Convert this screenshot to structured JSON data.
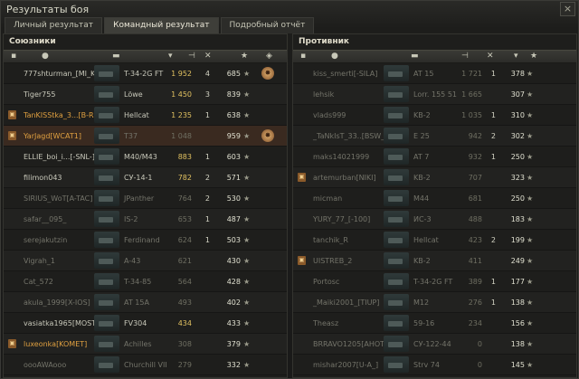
{
  "window": {
    "title": "Результаты боя",
    "close_label": "×"
  },
  "tabs": [
    {
      "label": "Личный результат",
      "active": false
    },
    {
      "label": "Командный результат",
      "active": true
    },
    {
      "label": "Подробный отчёт",
      "active": false
    }
  ],
  "allies": {
    "title": "Союзники",
    "rows": [
      {
        "player": "777shturman_[MI_KI]",
        "vehicle": "T-34-2G FT",
        "damage": "1 952",
        "kills": "4",
        "xp": "685",
        "dead": false,
        "platoon": false,
        "medal": true
      },
      {
        "player": "Tiger755",
        "vehicle": "Löwe",
        "damage": "1 450",
        "kills": "3",
        "xp": "839",
        "dead": false,
        "platoon": false,
        "medal": false
      },
      {
        "player": "TanKISStka_3...[B-RS]",
        "vehicle": "Hellcat",
        "damage": "1 235",
        "kills": "1",
        "xp": "638",
        "dead": false,
        "platoon": true,
        "medal": false,
        "orange": true
      },
      {
        "player": "YarJagd[WCAT1]",
        "vehicle": "T37",
        "damage": "1 048",
        "kills": "",
        "xp": "959",
        "dead": true,
        "platoon": true,
        "medal": true,
        "highlight": true,
        "orange": true
      },
      {
        "player": "ELLIE_boi_i...[-SNL-]",
        "vehicle": "M40/M43",
        "damage": "883",
        "kills": "1",
        "xp": "603",
        "dead": false,
        "platoon": false,
        "medal": false
      },
      {
        "player": "filimon043",
        "vehicle": "СУ-14-1",
        "damage": "782",
        "kills": "2",
        "xp": "571",
        "dead": false,
        "platoon": false,
        "medal": false
      },
      {
        "player": "SIRIUS_WoT[A-TAC]",
        "vehicle": "JPanther",
        "damage": "764",
        "kills": "2",
        "xp": "530",
        "dead": true,
        "platoon": false,
        "medal": false
      },
      {
        "player": "safar__095_",
        "vehicle": "IS-2",
        "damage": "653",
        "kills": "1",
        "xp": "487",
        "dead": true,
        "platoon": false,
        "medal": false
      },
      {
        "player": "serejakutzin",
        "vehicle": "Ferdinand",
        "damage": "624",
        "kills": "1",
        "xp": "503",
        "dead": true,
        "platoon": false,
        "medal": false
      },
      {
        "player": "Vigrah_1",
        "vehicle": "A-43",
        "damage": "621",
        "kills": "",
        "xp": "430",
        "dead": true,
        "platoon": false,
        "medal": false
      },
      {
        "player": "Cat_572",
        "vehicle": "T-34-85",
        "damage": "564",
        "kills": "",
        "xp": "428",
        "dead": true,
        "platoon": false,
        "medal": false
      },
      {
        "player": "akula_1999[X-IOS]",
        "vehicle": "AT 15A",
        "damage": "493",
        "kills": "",
        "xp": "402",
        "dead": true,
        "platoon": false,
        "medal": false
      },
      {
        "player": "vasiatka1965[MOST2]",
        "vehicle": "FV304",
        "damage": "434",
        "kills": "",
        "xp": "433",
        "dead": false,
        "platoon": false,
        "medal": false
      },
      {
        "player": "luxeonka[KOMET]",
        "vehicle": "Achilles",
        "damage": "308",
        "kills": "",
        "xp": "379",
        "dead": true,
        "platoon": true,
        "medal": false,
        "orange": true
      },
      {
        "player": "oooAWAooo",
        "vehicle": "Churchill VII",
        "damage": "279",
        "kills": "",
        "xp": "332",
        "dead": true,
        "platoon": false,
        "medal": false
      }
    ]
  },
  "enemies": {
    "title": "Противник",
    "rows": [
      {
        "player": "kiss_smerti[-SILA]",
        "vehicle": "AT 15",
        "damage": "1 721",
        "kills": "1",
        "xp": "378",
        "dead": true,
        "platoon": false
      },
      {
        "player": "lehsik",
        "vehicle": "Lorr. 155 51",
        "damage": "1 665",
        "kills": "",
        "xp": "307",
        "dead": true,
        "platoon": false
      },
      {
        "player": "vlads999",
        "vehicle": "KB-2",
        "damage": "1 035",
        "kills": "1",
        "xp": "310",
        "dead": true,
        "platoon": false
      },
      {
        "player": "_TaNkIsT_33..[BSW_]",
        "vehicle": "E 25",
        "damage": "942",
        "kills": "2",
        "xp": "302",
        "dead": true,
        "platoon": false
      },
      {
        "player": "maks14021999",
        "vehicle": "AT 7",
        "damage": "932",
        "kills": "1",
        "xp": "250",
        "dead": true,
        "platoon": false
      },
      {
        "player": "artemurban[NIKI]",
        "vehicle": "KB-2",
        "damage": "707",
        "kills": "",
        "xp": "323",
        "dead": true,
        "platoon": true
      },
      {
        "player": "micman",
        "vehicle": "M44",
        "damage": "681",
        "kills": "",
        "xp": "250",
        "dead": true,
        "platoon": false
      },
      {
        "player": "YURY_77_[-100]",
        "vehicle": "ИС-3",
        "damage": "488",
        "kills": "",
        "xp": "183",
        "dead": true,
        "platoon": false
      },
      {
        "player": "tanchik_R",
        "vehicle": "Hellcat",
        "damage": "423",
        "kills": "2",
        "xp": "199",
        "dead": true,
        "platoon": false
      },
      {
        "player": "UISTREB_2",
        "vehicle": "KB-2",
        "damage": "411",
        "kills": "",
        "xp": "249",
        "dead": true,
        "platoon": true
      },
      {
        "player": "Portosc",
        "vehicle": "T-34-2G FT",
        "damage": "389",
        "kills": "1",
        "xp": "177",
        "dead": true,
        "platoon": false
      },
      {
        "player": "_Maiki2001_[TIUP]",
        "vehicle": "M12",
        "damage": "276",
        "kills": "1",
        "xp": "138",
        "dead": true,
        "platoon": false
      },
      {
        "player": "Theasz",
        "vehicle": "59-16",
        "damage": "234",
        "kills": "",
        "xp": "156",
        "dead": true,
        "platoon": false
      },
      {
        "player": "BRRAVO1205[AHOTA]",
        "vehicle": "СУ-122-44",
        "damage": "0",
        "kills": "",
        "xp": "138",
        "dead": true,
        "platoon": false
      },
      {
        "player": "mishar2007[U-A_]",
        "vehicle": "Strv 74",
        "damage": "0",
        "kills": "",
        "xp": "145",
        "dead": true,
        "platoon": false
      }
    ]
  },
  "columns": {
    "star": "★",
    "sort_arrow": "▾"
  },
  "icons": {
    "platoon": "platoon-icon",
    "medal": "medal-icon",
    "star": "star-icon",
    "vehicle": "tank-icon"
  }
}
